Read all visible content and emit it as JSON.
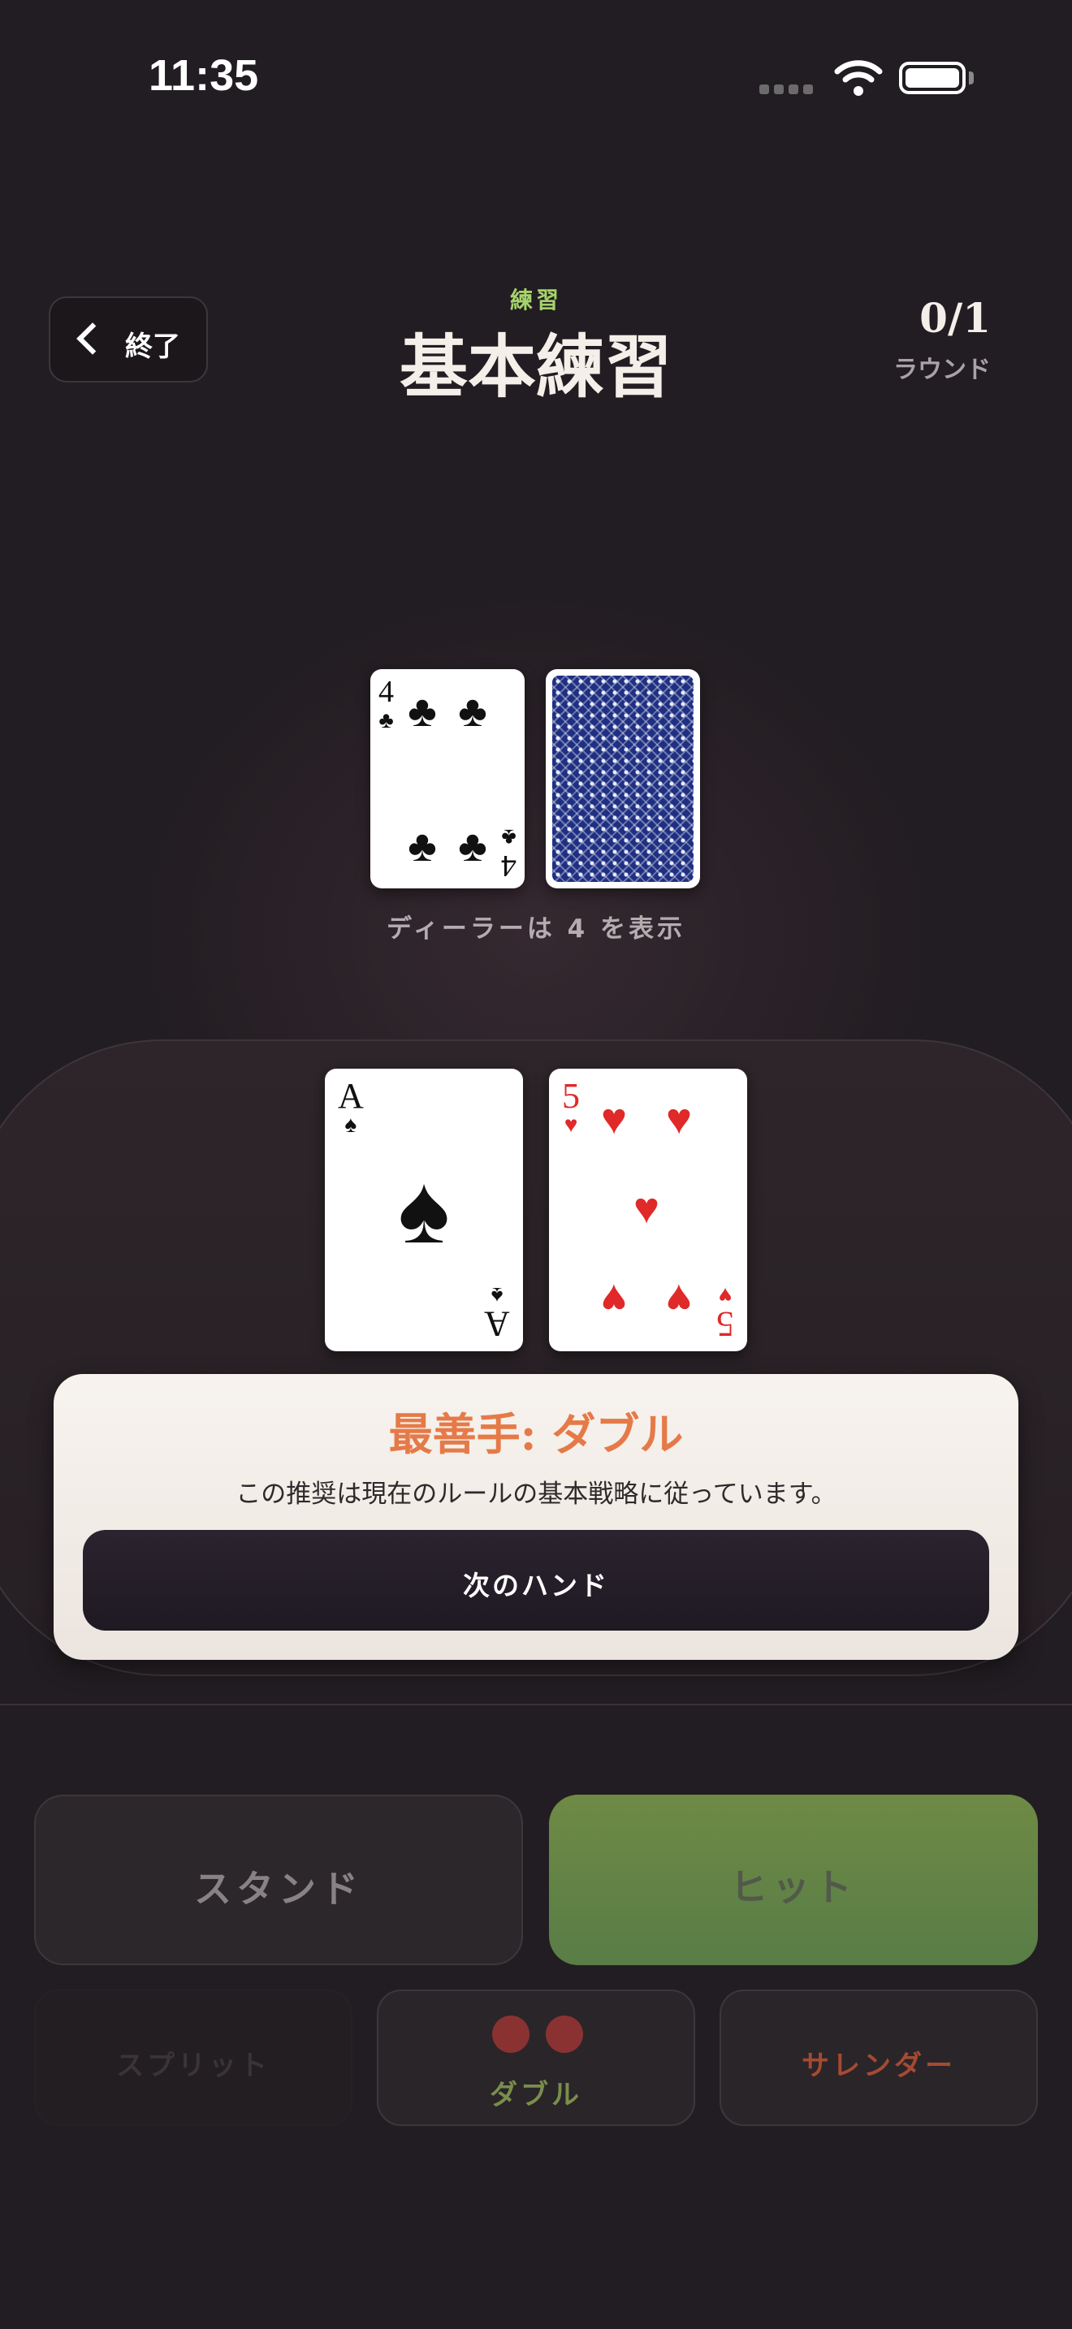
{
  "status_bar": {
    "time": "11:35"
  },
  "header": {
    "exit_label": "終了",
    "mode_label": "練習",
    "title": "基本練習",
    "round_count": "0/1",
    "round_label": "ラウンド"
  },
  "dealer": {
    "up_card": {
      "rank": "4",
      "suit": "♣"
    },
    "caption": "ディーラーは 4 を表示"
  },
  "player": {
    "cards": [
      {
        "rank": "A",
        "suit": "♠"
      },
      {
        "rank": "5",
        "suit": "♥"
      }
    ]
  },
  "advice": {
    "title": "最善手: ダブル",
    "text": "この推奨は現在のルールの基本戦略に従っています。",
    "next_label": "次のハンド"
  },
  "actions": {
    "stand": "スタンド",
    "hit": "ヒット",
    "split": "スプリット",
    "double": "ダブル",
    "surrender": "サレンダー"
  },
  "colors": {
    "background": "#221d22",
    "accent_green": "#a6d36a",
    "advice_orange": "#e57a48",
    "hit_green": "#6f8a45",
    "surrender_red": "#a64a32"
  }
}
